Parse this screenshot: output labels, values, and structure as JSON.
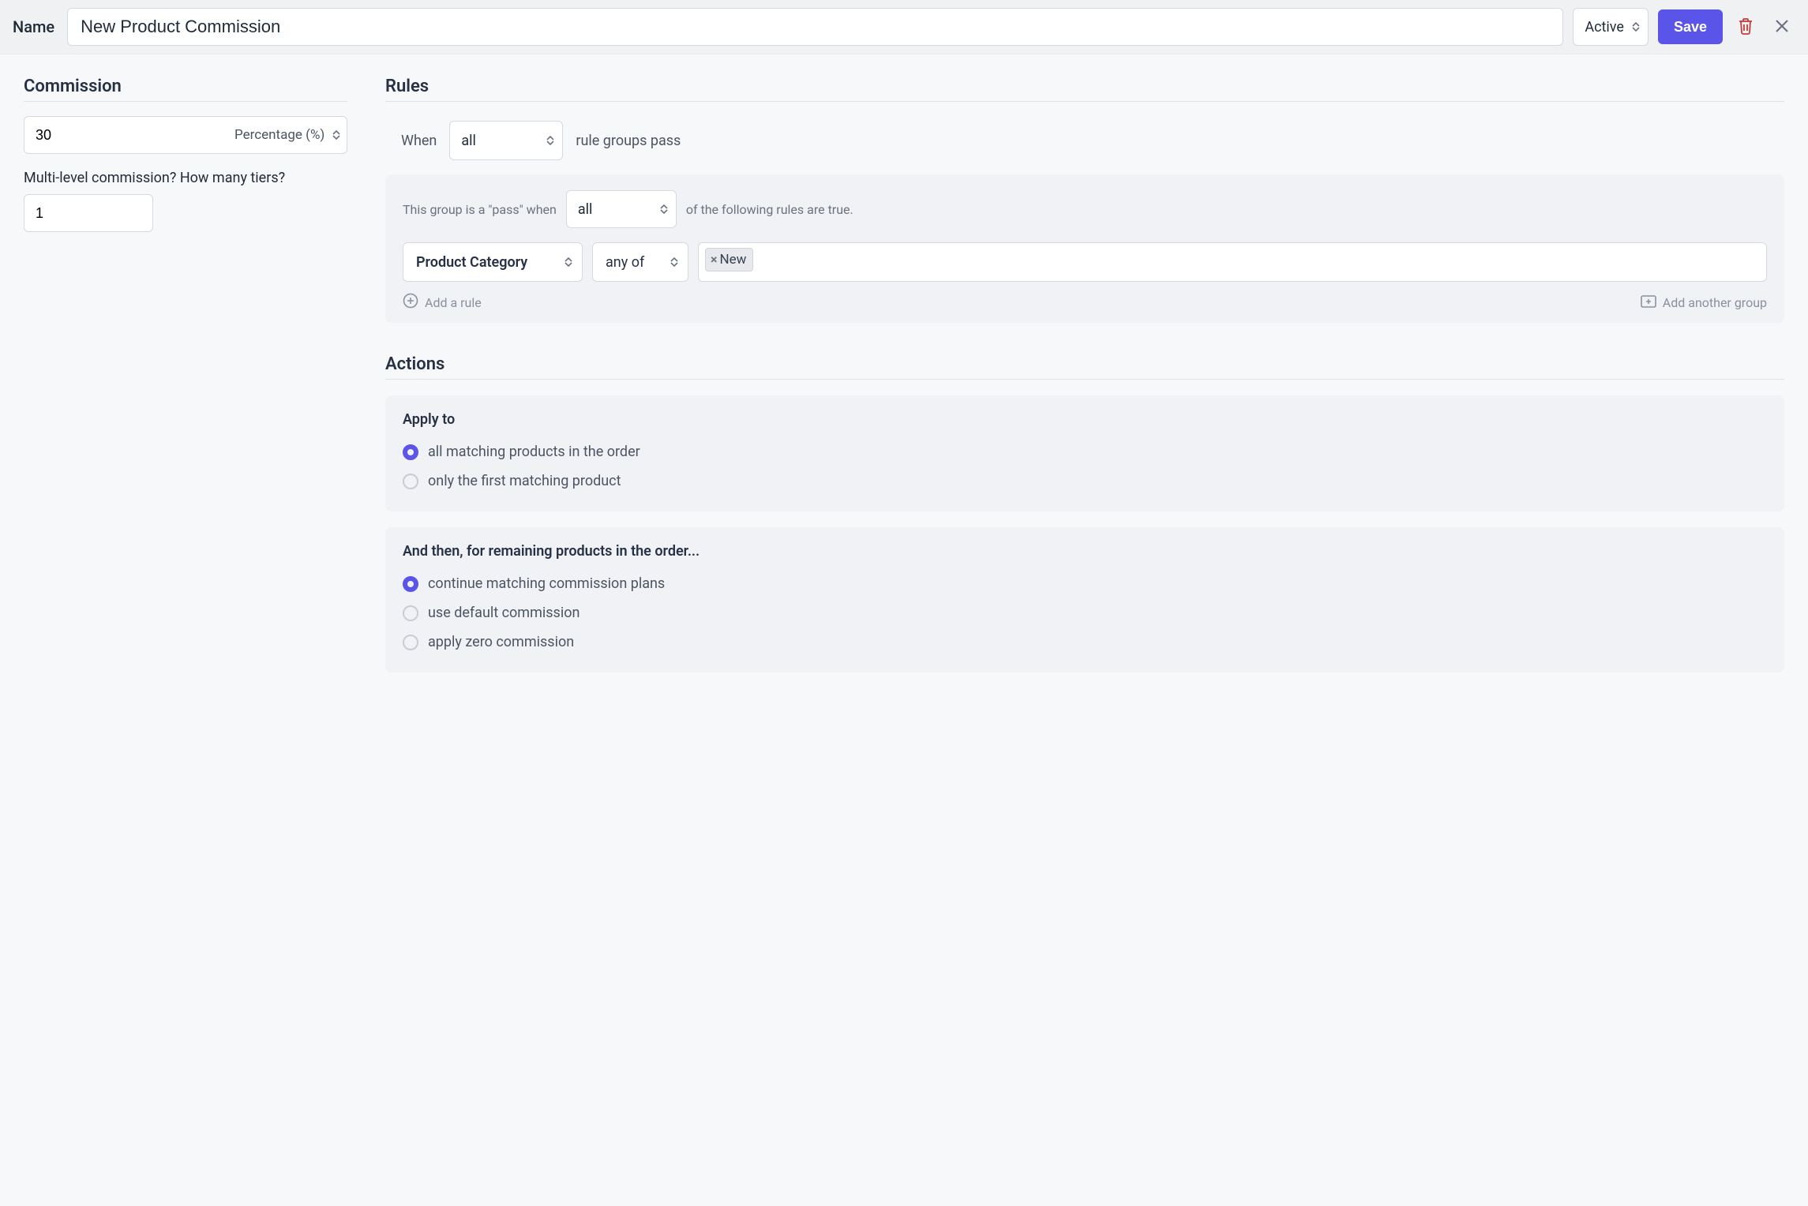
{
  "header": {
    "nameLabel": "Name",
    "nameValue": "New Product Commission",
    "status": "Active",
    "saveLabel": "Save"
  },
  "commission": {
    "title": "Commission",
    "value": "30",
    "typeLabel": "Percentage (%)",
    "multiLevelLabel": "Multi-level commission? How many tiers?",
    "tiersValue": "1"
  },
  "rules": {
    "title": "Rules",
    "whenLabel": "When",
    "whenMode": "all",
    "whenSuffix": "rule groups pass",
    "group": {
      "prefix": "This group is a \"pass\" when",
      "mode": "all",
      "suffix": "of the following rules are true.",
      "ruleField": "Product Category",
      "ruleOp": "any of",
      "tag": "New",
      "addRule": "Add a rule",
      "addGroup": "Add another group"
    }
  },
  "actions": {
    "title": "Actions",
    "applyTo": {
      "heading": "Apply to",
      "opt1": "all matching products in the order",
      "opt2": "only the first matching product"
    },
    "remaining": {
      "heading": "And then, for remaining products in the order...",
      "opt1": "continue matching commission plans",
      "opt2": "use default commission",
      "opt3": "apply zero commission"
    }
  }
}
